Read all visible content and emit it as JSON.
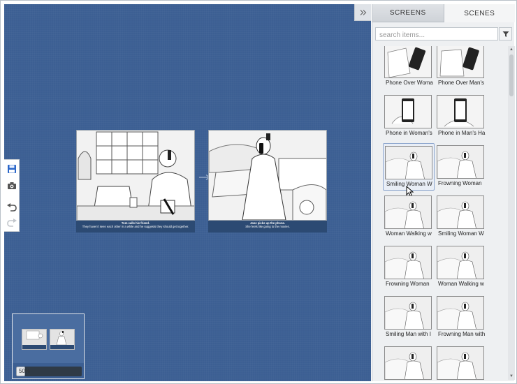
{
  "panel": {
    "tabs": [
      {
        "label": "SCREENS",
        "active": false
      },
      {
        "label": "SCENES",
        "active": true
      }
    ],
    "search_placeholder": "search items...",
    "items": [
      {
        "label": "Phone Over Woman"
      },
      {
        "label": "Phone Over Man's"
      },
      {
        "label": "Phone in Woman's"
      },
      {
        "label": "Phone in Man's Ha"
      },
      {
        "label": "Smiling Woman W",
        "selected": true
      },
      {
        "label": "Frowning Woman"
      },
      {
        "label": "Woman Walking w"
      },
      {
        "label": "Smiling Woman W"
      },
      {
        "label": "Frowning Woman"
      },
      {
        "label": "Woman Walking w"
      },
      {
        "label": "Smiling Man with I"
      },
      {
        "label": "Frowning Man with"
      },
      {
        "label": ""
      },
      {
        "label": ""
      }
    ]
  },
  "storyboard": {
    "frames": [
      {
        "title": "Tom calls his friend.",
        "caption": "They haven't seen each other in a while and he suggests they should get together."
      },
      {
        "title": "Jane picks up the phone.",
        "caption": "She feels like going to the movies."
      }
    ]
  },
  "navigator": {
    "zoom_percent": 50,
    "zoom_label": "50%"
  },
  "colors": {
    "canvas": "#3c5f93",
    "caption_bg": "#2c4a73",
    "save_icon": "#2a66c9"
  },
  "icons": {
    "collapse": "double-chevron-right-icon",
    "filter": "filter-icon",
    "save": "save-icon",
    "screenshot": "camera-icon",
    "undo": "undo-icon",
    "redo": "redo-icon"
  }
}
